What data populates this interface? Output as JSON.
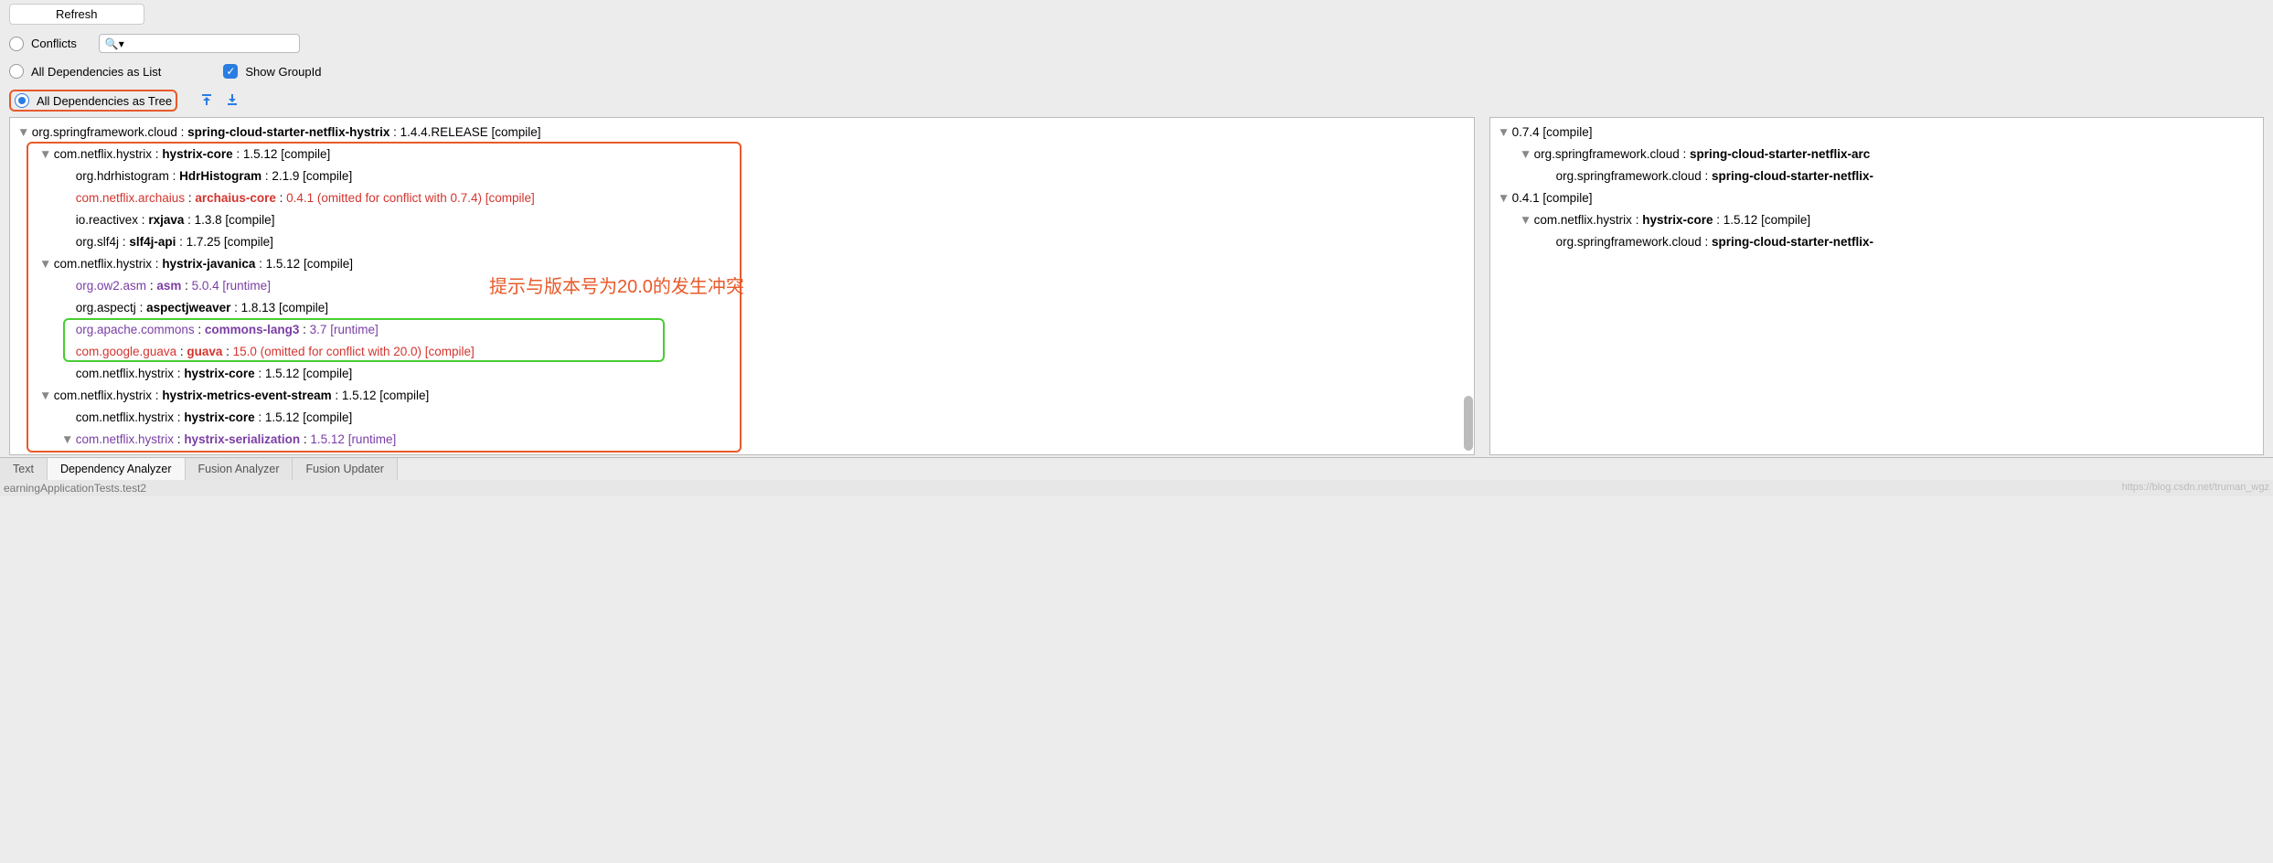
{
  "toolbar": {
    "refresh_label": "Refresh"
  },
  "filters": {
    "conflicts_label": "Conflicts",
    "all_list_label": "All Dependencies as List",
    "all_tree_label": "All Dependencies as Tree",
    "show_groupid_label": "Show GroupId",
    "search_placeholder": ""
  },
  "left_tree": [
    {
      "indent": 0,
      "disclosure": "▼",
      "cls": "",
      "group": "org.springframework.cloud",
      "artifact": "spring-cloud-starter-netflix-hystrix",
      "version": "1.4.4.RELEASE",
      "scope": "[compile]"
    },
    {
      "indent": 1,
      "disclosure": "▼",
      "cls": "",
      "group": "com.netflix.hystrix",
      "artifact": "hystrix-core",
      "version": "1.5.12",
      "scope": "[compile]"
    },
    {
      "indent": 2,
      "disclosure": "",
      "cls": "",
      "group": "org.hdrhistogram",
      "artifact": "HdrHistogram",
      "version": "2.1.9",
      "scope": "[compile]"
    },
    {
      "indent": 2,
      "disclosure": "",
      "cls": "red",
      "group": "com.netflix.archaius",
      "artifact": "archaius-core",
      "version": "0.4.1 (omitted for conflict with 0.7.4)",
      "scope": "[compile]"
    },
    {
      "indent": 2,
      "disclosure": "",
      "cls": "",
      "group": "io.reactivex",
      "artifact": "rxjava",
      "version": "1.3.8",
      "scope": "[compile]"
    },
    {
      "indent": 2,
      "disclosure": "",
      "cls": "",
      "group": "org.slf4j",
      "artifact": "slf4j-api",
      "version": "1.7.25",
      "scope": "[compile]"
    },
    {
      "indent": 1,
      "disclosure": "▼",
      "cls": "",
      "group": "com.netflix.hystrix",
      "artifact": "hystrix-javanica",
      "version": "1.5.12",
      "scope": "[compile]"
    },
    {
      "indent": 2,
      "disclosure": "",
      "cls": "purple",
      "group": "org.ow2.asm",
      "artifact": "asm",
      "version": "5.0.4",
      "scope": "[runtime]"
    },
    {
      "indent": 2,
      "disclosure": "",
      "cls": "",
      "group": "org.aspectj",
      "artifact": "aspectjweaver",
      "version": "1.8.13",
      "scope": "[compile]"
    },
    {
      "indent": 2,
      "disclosure": "",
      "cls": "purple",
      "group": "org.apache.commons",
      "artifact": "commons-lang3",
      "version": "3.7",
      "scope": "[runtime]"
    },
    {
      "indent": 2,
      "disclosure": "",
      "cls": "red",
      "group": "com.google.guava",
      "artifact": "guava",
      "version": "15.0 (omitted for conflict with 20.0)",
      "scope": "[compile]"
    },
    {
      "indent": 2,
      "disclosure": "",
      "cls": "",
      "group": "com.netflix.hystrix",
      "artifact": "hystrix-core",
      "version": "1.5.12",
      "scope": "[compile]"
    },
    {
      "indent": 1,
      "disclosure": "▼",
      "cls": "",
      "group": "com.netflix.hystrix",
      "artifact": "hystrix-metrics-event-stream",
      "version": "1.5.12",
      "scope": "[compile]"
    },
    {
      "indent": 2,
      "disclosure": "",
      "cls": "",
      "group": "com.netflix.hystrix",
      "artifact": "hystrix-core",
      "version": "1.5.12",
      "scope": "[compile]"
    },
    {
      "indent": 2,
      "disclosure": "▼",
      "cls": "purple",
      "group": "com.netflix.hystrix",
      "artifact": "hystrix-serialization",
      "version": "1.5.12",
      "scope": "[runtime]"
    }
  ],
  "right_tree": [
    {
      "indent": 0,
      "disclosure": "▼",
      "cls": "",
      "text": "0.7.4 [compile]"
    },
    {
      "indent": 1,
      "disclosure": "▼",
      "cls": "",
      "group": "org.springframework.cloud",
      "artifact": "spring-cloud-starter-netflix-arc",
      "version": "",
      "scope": ""
    },
    {
      "indent": 2,
      "disclosure": "",
      "cls": "",
      "group": "org.springframework.cloud",
      "artifact": "spring-cloud-starter-netflix-",
      "version": "",
      "scope": ""
    },
    {
      "indent": 0,
      "disclosure": "▼",
      "cls": "red",
      "text": "0.4.1 [compile]"
    },
    {
      "indent": 1,
      "disclosure": "▼",
      "cls": "",
      "group": "com.netflix.hystrix",
      "artifact": "hystrix-core",
      "version": "1.5.12",
      "scope": "[compile]"
    },
    {
      "indent": 2,
      "disclosure": "",
      "cls": "",
      "group": "org.springframework.cloud",
      "artifact": "spring-cloud-starter-netflix-",
      "version": "",
      "scope": ""
    }
  ],
  "annotation_text": "提示与版本号为20.0的发生冲突",
  "tabs": {
    "text": "Text",
    "dep_analyzer": "Dependency Analyzer",
    "fusion_analyzer": "Fusion Analyzer",
    "fusion_updater": "Fusion Updater"
  },
  "status": {
    "left": "earningApplicationTests.test2",
    "right": "https://blog.csdn.net/truman_wgz"
  }
}
